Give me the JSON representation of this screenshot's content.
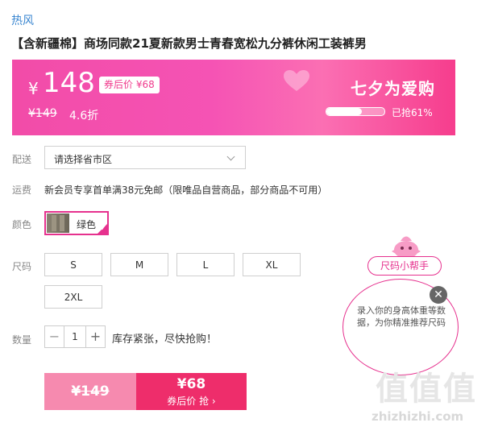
{
  "brand": "热风",
  "product": {
    "title": "【含新疆棉】商场同款21夏新款男士青春宽松九分裤休闲工装裤男"
  },
  "banner": {
    "currency": "¥",
    "price": "148",
    "coupon_label": "券后价 ¥68",
    "original_price": "¥149",
    "discount": "4.6折",
    "promo_title": "七夕为爱购",
    "sold_text": "已抢61%",
    "sold_fraction": 0.61,
    "colors": {
      "start": "#f24ca8",
      "end": "#f63d8d"
    }
  },
  "shipping": {
    "label": "配送",
    "region_placeholder": "请选择省市区"
  },
  "freight": {
    "label": "运费",
    "text": "新会员专享首单满38元免邮（限唯品自营商品，部分商品不可用）"
  },
  "color": {
    "label": "颜色",
    "selected": "绿色"
  },
  "size": {
    "label": "尺码",
    "options": [
      "S",
      "M",
      "L",
      "XL",
      "2XL"
    ]
  },
  "quantity": {
    "label": "数量",
    "minus": "−",
    "value": "1",
    "plus": "+",
    "stock_note": "库存紧张，尽快抢购！"
  },
  "buy": {
    "original_price": "¥149",
    "coupon_price": "¥68",
    "coupon_action": "券后价 抢 ›"
  },
  "size_helper": {
    "button": "尺码小帮手",
    "tip": "录入你的身高体重等数据，为你精准推荐尺码",
    "close": "✕"
  },
  "watermark": {
    "big": "值值值",
    "site": "zhizhizhi.com"
  },
  "accent": "#e6318e"
}
